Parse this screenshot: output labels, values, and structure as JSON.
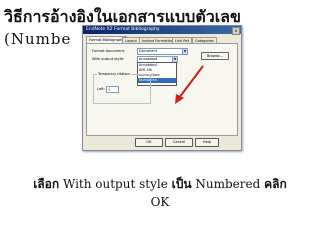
{
  "slide": {
    "title_line1": "วิธีการอ้างอิงในเอกสารแบบตัวเลข",
    "title_line2": "(Numbe"
  },
  "dialog": {
    "window_title": "EndNote X2 Format Bibliography",
    "close_glyph": "x",
    "tabs": [
      "Format Bibliography",
      "Layout",
      "Instant Formatting",
      "Link Ref",
      "Categories"
    ],
    "format_document_label": "Format document:",
    "format_document_value": "Document",
    "output_style_label": "With output style:",
    "output_style_value": "Annotated",
    "browse_label": "Browse...",
    "style_options": [
      "Annotated",
      "APA 5th",
      "Author-Date",
      "Numbered"
    ],
    "selected_option": "Numbered",
    "temporary_citations_label": "Temporary citation",
    "left_label": "Left:",
    "left_value": "{",
    "buttons": {
      "ok": "OK",
      "cancel": "Cancel",
      "help": "Help"
    }
  },
  "arrow_color": "#cc1f1f",
  "caption": {
    "select_word": "เลือก",
    "phrase1": "With output style",
    "be_word": "เป็น",
    "phrase2": "Numbered",
    "click_word": "คลิก",
    "ok_word": "OK"
  }
}
